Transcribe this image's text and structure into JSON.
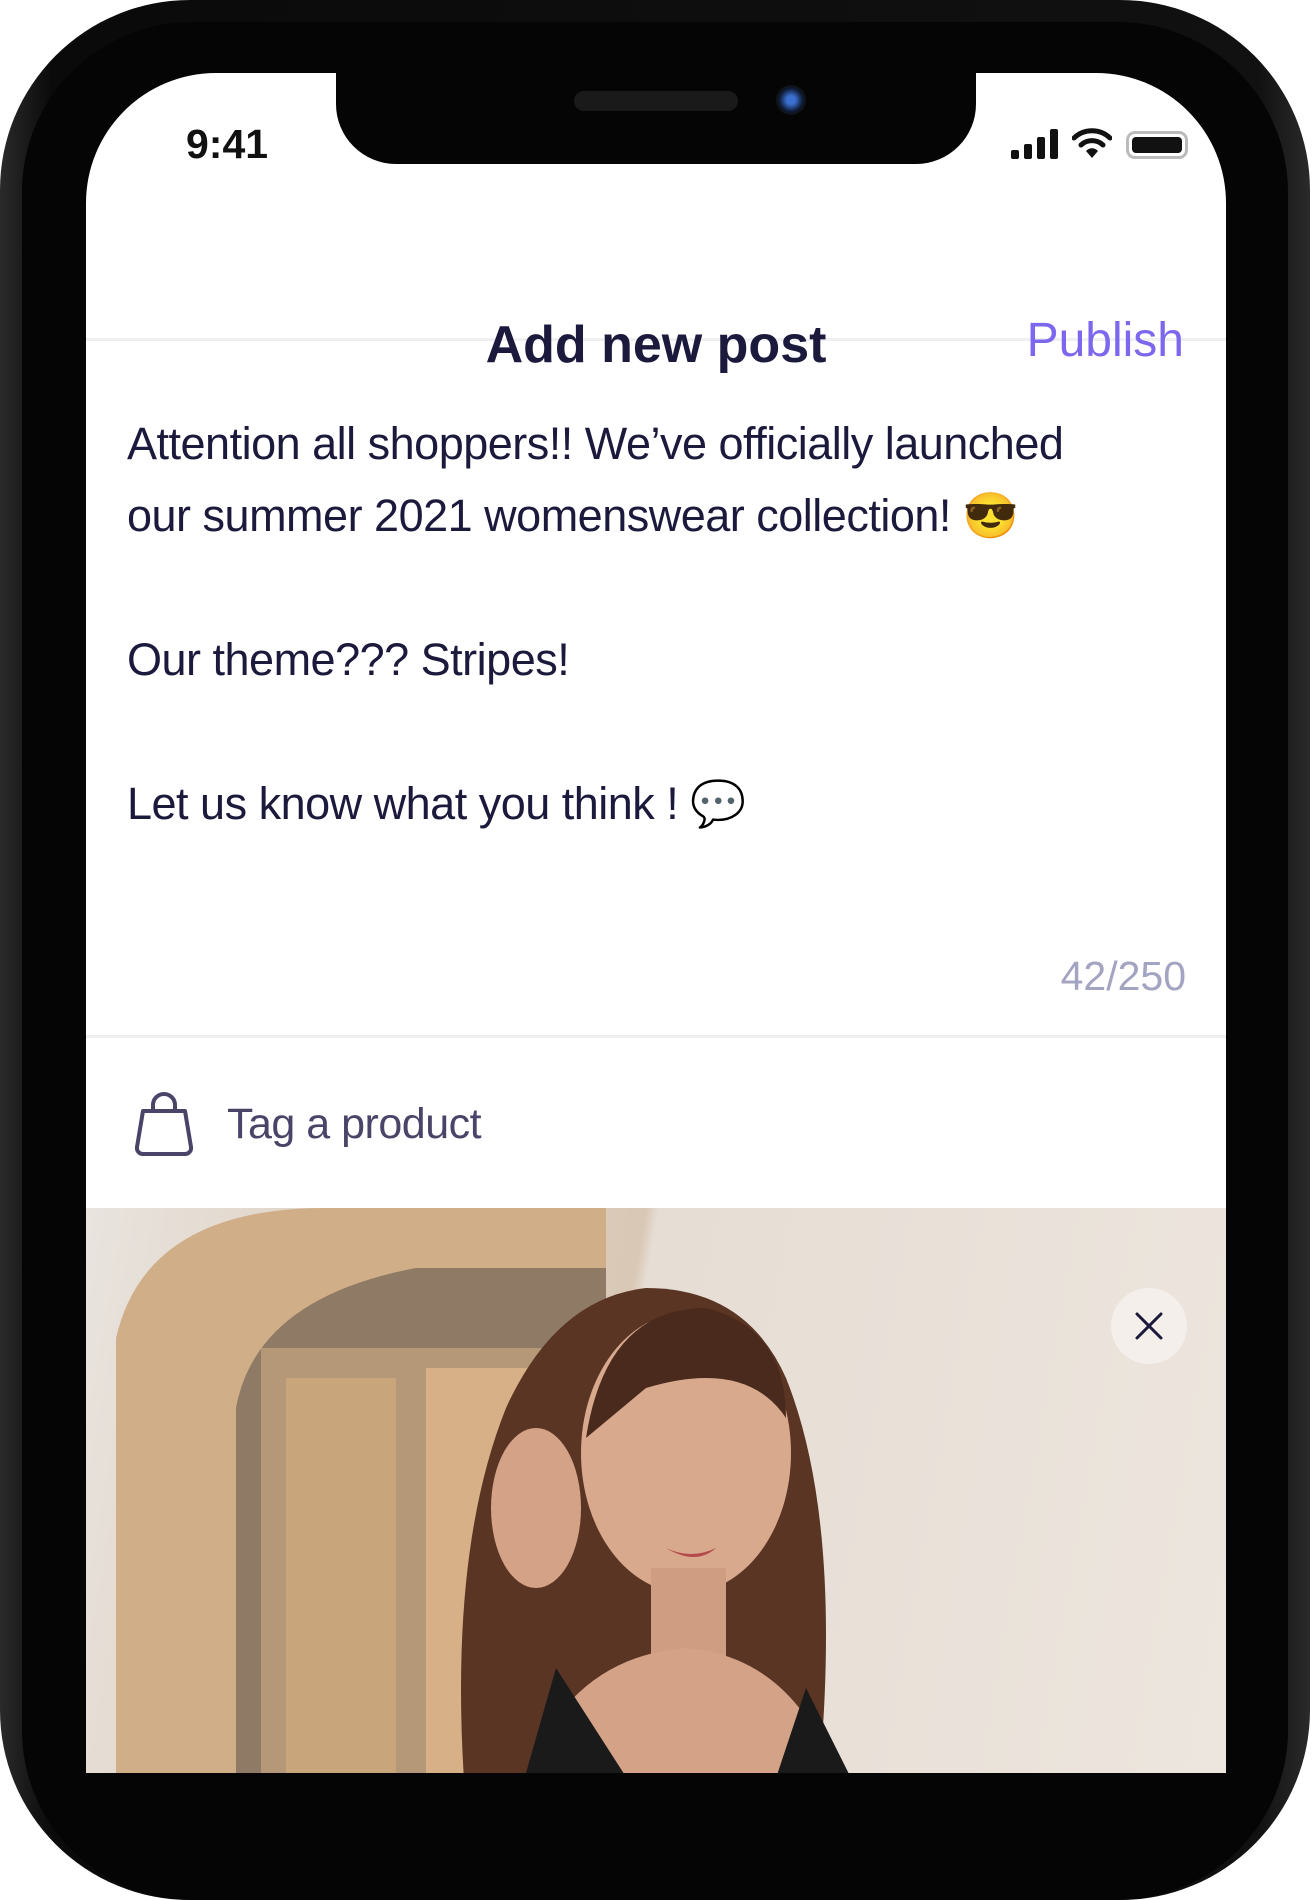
{
  "status_bar": {
    "time": "9:41",
    "icons": [
      "signal-icon",
      "wifi-icon",
      "battery-icon"
    ]
  },
  "header": {
    "title": "Add new post",
    "publish_label": "Publish"
  },
  "post": {
    "lines": [
      "Attention all shoppers!!  We’ve officially launched",
      "our summer 2021 womenswear  collection! 😎",
      "Our theme??? Stripes!",
      "Let us know what you think ! 💬"
    ],
    "char_count": "42/250"
  },
  "tag_product": {
    "label": "Tag a product",
    "icon": "shopping-bag-icon"
  },
  "photo": {
    "remove_icon": "close-icon"
  },
  "colors": {
    "accent": "#7b68ee",
    "text": "#1c1a3c",
    "muted": "#a3a3c2"
  }
}
